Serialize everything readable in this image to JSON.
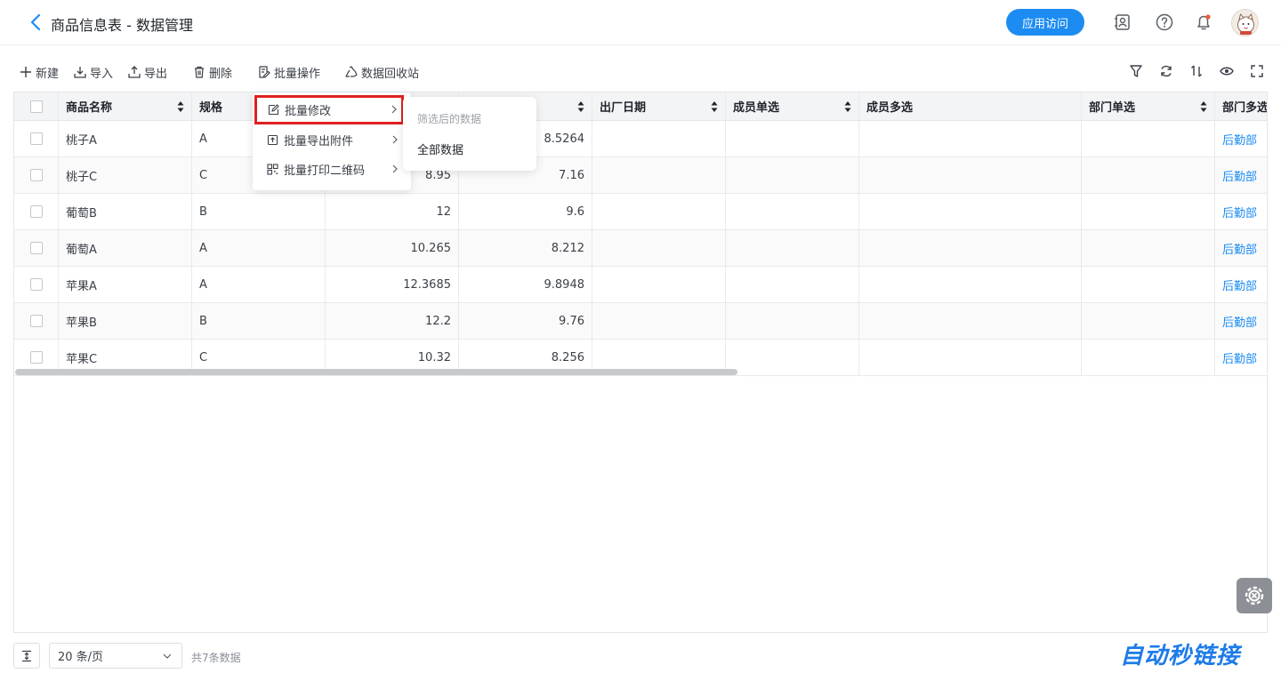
{
  "header": {
    "title": "商品信息表 - 数据管理",
    "visit_button": "应用访问",
    "icons": [
      "back-chevron-icon",
      "contacts-icon",
      "help-icon",
      "bell-icon",
      "avatar"
    ]
  },
  "toolbar": {
    "new": "新建",
    "import": "导入",
    "export": "导出",
    "delete": "删除",
    "batch": "批量操作",
    "recycle": "数据回收站",
    "right_icons": [
      "filter-icon",
      "refresh-icon",
      "sort-icon",
      "eye-icon",
      "fullscreen-icon"
    ]
  },
  "table": {
    "columns": [
      "商品名称",
      "规格",
      "",
      "",
      "出厂日期",
      "成员单选",
      "成员多选",
      "部门单选",
      "部门多选"
    ],
    "rows": [
      {
        "name": "桃子A",
        "spec": "A",
        "v1": "",
        "v2": "8.5264",
        "dept": "后勤部"
      },
      {
        "name": "桃子C",
        "spec": "C",
        "v1": "8.95",
        "v2": "7.16",
        "dept": "后勤部"
      },
      {
        "name": "葡萄B",
        "spec": "B",
        "v1": "12",
        "v2": "9.6",
        "dept": "后勤部"
      },
      {
        "name": "葡萄A",
        "spec": "A",
        "v1": "10.265",
        "v2": "8.212",
        "dept": "后勤部"
      },
      {
        "name": "苹果A",
        "spec": "A",
        "v1": "12.3685",
        "v2": "9.8948",
        "dept": "后勤部"
      },
      {
        "name": "苹果B",
        "spec": "B",
        "v1": "12.2",
        "v2": "9.76",
        "dept": "后勤部"
      },
      {
        "name": "苹果C",
        "spec": "C",
        "v1": "10.32",
        "v2": "8.256",
        "dept": "后勤部"
      }
    ]
  },
  "batch_menu": {
    "items": [
      "批量修改",
      "批量导出附件",
      "批量打印二维码"
    ],
    "highlight_color": "#e02020"
  },
  "submenu": {
    "hint": "筛选后的数据",
    "item": "全部数据"
  },
  "footer": {
    "page_size": "20 条/页",
    "total": "共7条数据"
  },
  "watermark": "自动秒链接",
  "colors": {
    "accent": "#1c8cf2",
    "link": "#1c8cf2"
  }
}
